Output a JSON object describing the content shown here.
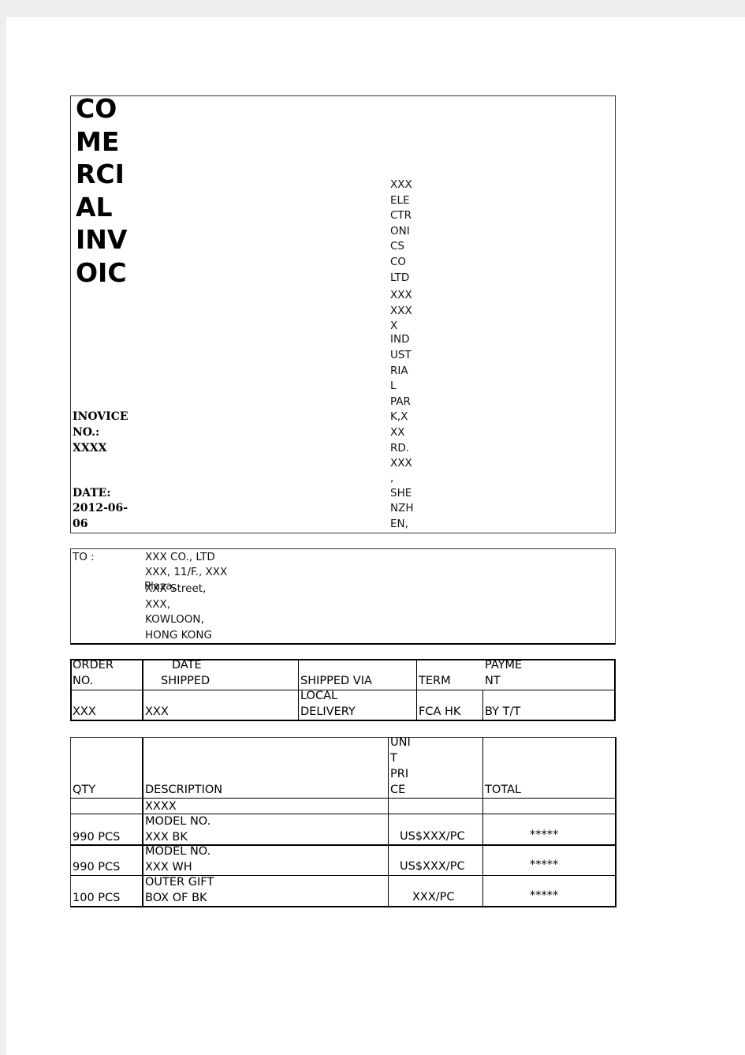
{
  "header": {
    "title_lines": [
      "CO",
      "ME",
      "RCI",
      "AL",
      "INV",
      "OIC"
    ],
    "company_lines": [
      "XXX",
      "ELE",
      "CTR",
      "ONI",
      "CS",
      "CO",
      "LTD",
      "XXX",
      "XXX",
      "X",
      "IND",
      "UST",
      "RIA",
      "L",
      "PAR",
      "K,X",
      "XX",
      "RD.",
      "XXX",
      ",",
      "SHE",
      "NZH",
      "EN,"
    ],
    "invoice_no_lines": [
      "INOVICE",
      "NO.:",
      "XXXX"
    ],
    "date_lines": [
      "DATE:",
      "2012-06-",
      "06"
    ]
  },
  "to": {
    "label": "TO :",
    "lines": [
      "XXX CO., LTD",
      "XXX, 11/F., XXX",
      "XXX Street,",
      "XXX,",
      "KOWLOON,",
      "HONG KONG"
    ],
    "overlap": "Plaza,"
  },
  "shipping": {
    "headers": {
      "order": [
        "ORDER",
        "NO."
      ],
      "date": [
        "DATE",
        "SHIPPED"
      ],
      "via": "SHIPPED VIA",
      "term": "TERM",
      "payment": [
        "PAYME",
        "NT"
      ]
    },
    "values": {
      "order": "XXX",
      "date": "XXX",
      "via": [
        "LOCAL",
        "DELIVERY"
      ],
      "term": "FCA HK",
      "payment": "BY T/T"
    }
  },
  "items": {
    "headers": {
      "qty": "QTY",
      "description": "DESCRIPTION",
      "unit_price": [
        "UNI",
        "T",
        "PRI",
        "CE"
      ],
      "total": "TOTAL"
    },
    "rows": [
      {
        "qty": "",
        "description": [
          "XXXX"
        ],
        "unit_price": "",
        "total": ""
      },
      {
        "qty": "990 PCS",
        "description": [
          "MODEL NO.",
          "XXX BK"
        ],
        "unit_price": "US$XXX/PC",
        "total": "*****"
      },
      {
        "qty": "990 PCS",
        "description": [
          "MODEL NO.",
          "XXX WH"
        ],
        "unit_price": "US$XXX/PC",
        "total": "*****"
      },
      {
        "qty": "100 PCS",
        "description": [
          "OUTER GIFT",
          "BOX OF BK"
        ],
        "unit_price": "XXX/PC",
        "total": "*****"
      }
    ]
  }
}
